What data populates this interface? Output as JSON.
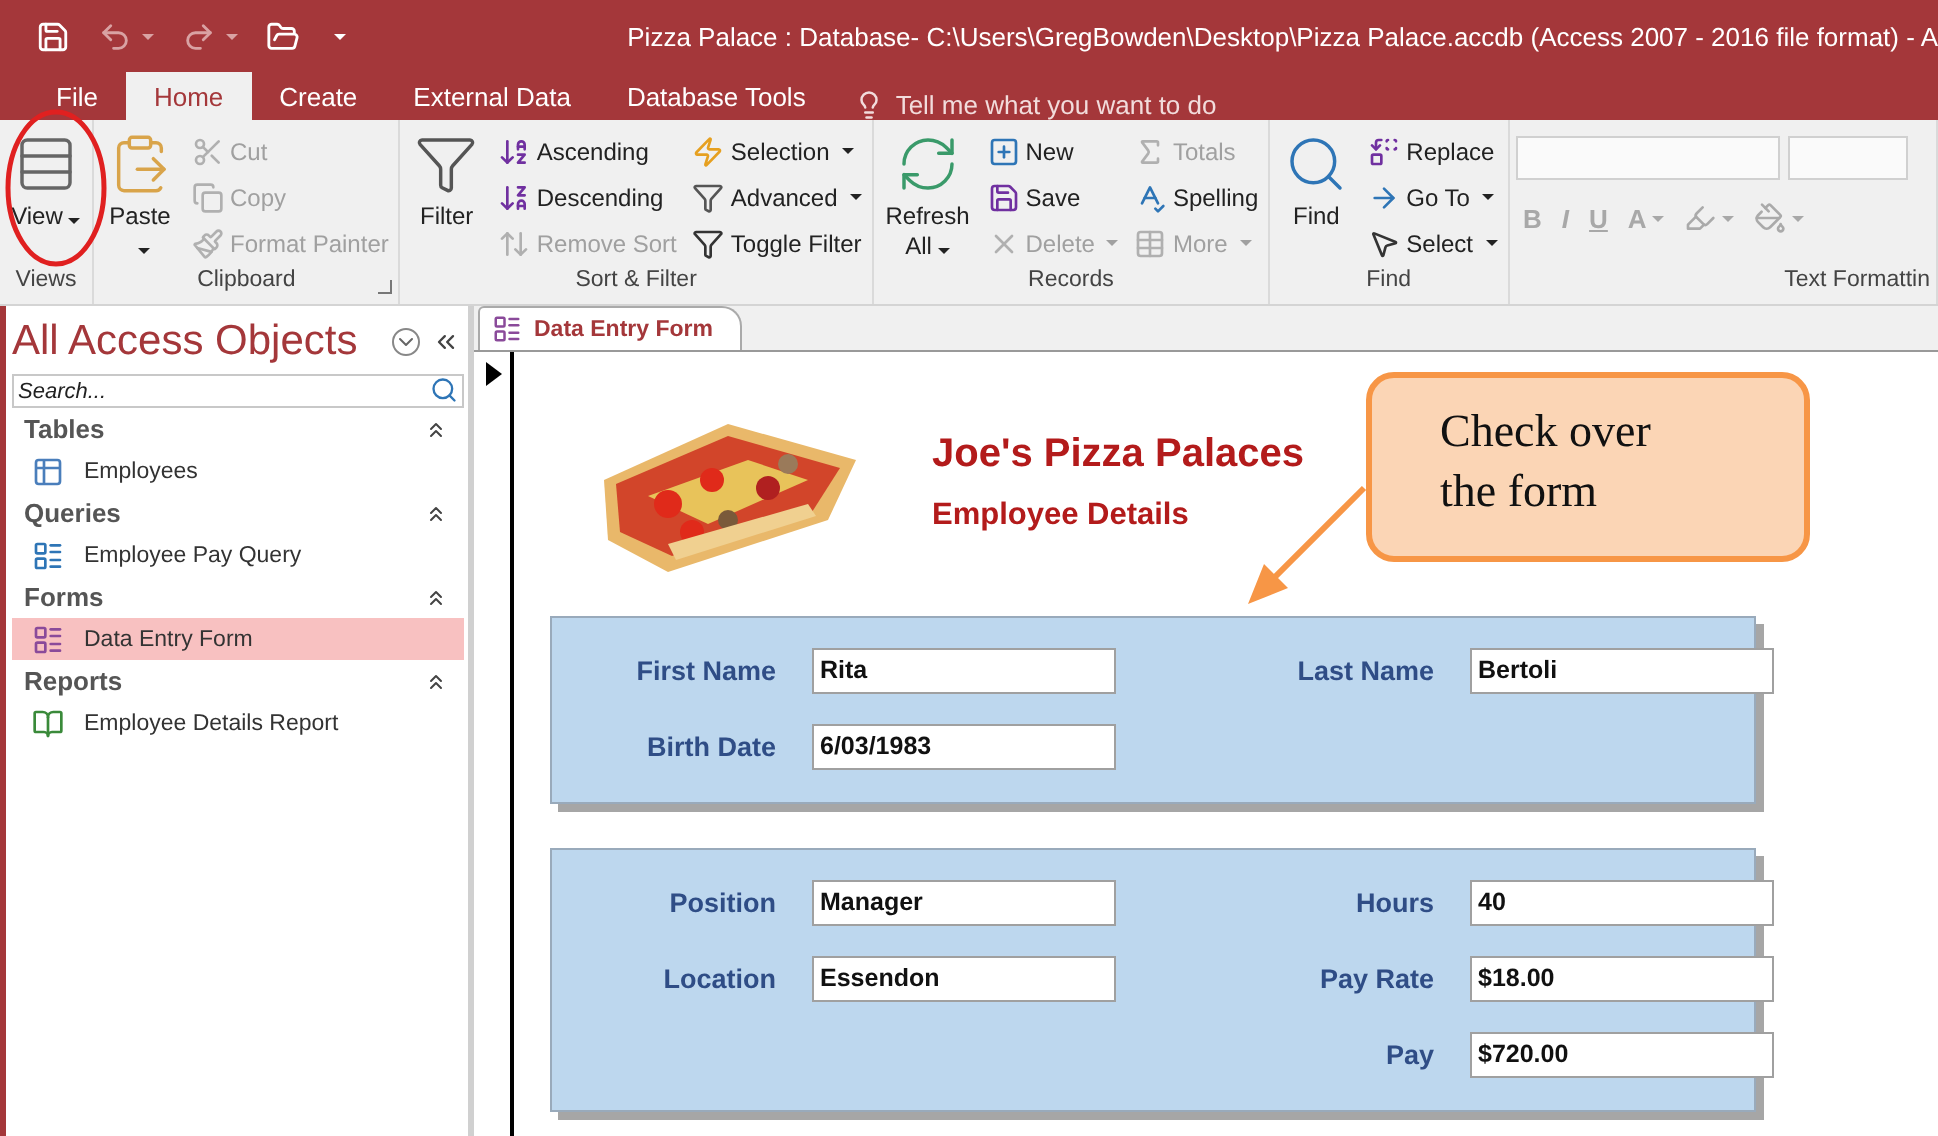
{
  "quick_access": [
    {
      "disabled": false,
      "dropdown": false
    },
    {
      "disabled": true,
      "dropdown": true
    },
    {
      "disabled": true,
      "dropdown": true
    },
    {
      "disabled": false,
      "dropdown": false
    },
    {
      "disabled": false,
      "dropdown": true
    }
  ],
  "window": {
    "title": "Pizza Palace : Database- C:\\Users\\GregBowden\\Desktop\\Pizza Palace.accdb (Access 2007 - 2016 file format) - A"
  },
  "ribbon_tabs": [
    {
      "label": "File",
      "selected": false
    },
    {
      "label": "Home",
      "selected": true
    },
    {
      "label": "Create",
      "selected": false
    },
    {
      "label": "External Data",
      "selected": false
    },
    {
      "label": "Database Tools",
      "selected": false
    }
  ],
  "tell_me": {
    "placeholder": "Tell me what you want to do"
  },
  "ribbon_groups": [
    {
      "label": "Views",
      "launcher": false,
      "items": [
        {
          "kind": "large",
          "label": "View",
          "disabled": false,
          "dropdown": true
        }
      ]
    },
    {
      "label": "Clipboard",
      "launcher": true,
      "items": [
        {
          "kind": "large",
          "label": "Paste",
          "disabled": false,
          "dropdown": true
        },
        {
          "kind": "small",
          "label": "Cut",
          "disabled": true,
          "dropdown": false
        },
        {
          "kind": "small",
          "label": "Copy",
          "disabled": true,
          "dropdown": false
        },
        {
          "kind": "small",
          "label": "Format Painter",
          "disabled": true,
          "dropdown": false
        }
      ]
    },
    {
      "label": "Sort & Filter",
      "launcher": false,
      "items": [
        {
          "kind": "large",
          "label": "Filter",
          "disabled": false,
          "dropdown": false
        },
        {
          "kind": "small",
          "label": "Ascending",
          "disabled": false,
          "dropdown": false
        },
        {
          "kind": "small",
          "label": "Descending",
          "disabled": false,
          "dropdown": false
        },
        {
          "kind": "small",
          "label": "Remove Sort",
          "disabled": true,
          "dropdown": false
        },
        {
          "kind": "small",
          "label": "Selection",
          "disabled": false,
          "dropdown": true
        },
        {
          "kind": "small",
          "label": "Advanced",
          "disabled": false,
          "dropdown": true
        },
        {
          "kind": "small",
          "label": "Toggle Filter",
          "disabled": false,
          "dropdown": false
        }
      ]
    },
    {
      "label": "Records",
      "launcher": false,
      "items": [
        {
          "kind": "large",
          "label": "Refresh All",
          "disabled": false,
          "dropdown": true
        },
        {
          "kind": "small",
          "label": "New",
          "disabled": false,
          "dropdown": false
        },
        {
          "kind": "small",
          "label": "Save",
          "disabled": false,
          "dropdown": false
        },
        {
          "kind": "small",
          "label": "Delete",
          "disabled": true,
          "dropdown": true
        },
        {
          "kind": "small",
          "label": "Totals",
          "disabled": true,
          "dropdown": false
        },
        {
          "kind": "small",
          "label": "Spelling",
          "disabled": false,
          "dropdown": false
        },
        {
          "kind": "small",
          "label": "More",
          "disabled": true,
          "dropdown": true
        }
      ]
    },
    {
      "label": "Find",
      "launcher": false,
      "items": [
        {
          "kind": "large",
          "label": "Find",
          "disabled": false,
          "dropdown": false
        },
        {
          "kind": "small",
          "label": "Replace",
          "disabled": false,
          "dropdown": false
        },
        {
          "kind": "small",
          "label": "Go To",
          "disabled": false,
          "dropdown": true
        },
        {
          "kind": "small",
          "label": "Select",
          "disabled": false,
          "dropdown": true
        }
      ]
    },
    {
      "label": "Text Formattin",
      "launcher": false,
      "items": [
        {
          "kind": "combo",
          "disabled": true
        },
        {
          "kind": "combo",
          "disabled": true
        },
        {
          "kind": "format",
          "label": "B",
          "disabled": true,
          "dropdown": false
        },
        {
          "kind": "format",
          "label": "I",
          "disabled": true,
          "dropdown": false
        },
        {
          "kind": "format",
          "label": "U",
          "disabled": true,
          "dropdown": false
        },
        {
          "kind": "format",
          "label": "A",
          "disabled": true,
          "dropdown": true
        },
        {
          "kind": "format",
          "disabled": true,
          "dropdown": true
        },
        {
          "kind": "format",
          "disabled": true,
          "dropdown": true
        }
      ]
    }
  ],
  "navigation": {
    "title": "All Access Objects",
    "search": {
      "placeholder": "Search..."
    },
    "groups": [
      {
        "label": "Tables",
        "expanded": true,
        "items": [
          {
            "label": "Employees",
            "selected": false
          }
        ]
      },
      {
        "label": "Queries",
        "expanded": true,
        "items": [
          {
            "label": "Employee Pay Query",
            "selected": false
          }
        ]
      },
      {
        "label": "Forms",
        "expanded": true,
        "items": [
          {
            "label": "Data Entry Form",
            "selected": true
          }
        ]
      },
      {
        "label": "Reports",
        "expanded": true,
        "items": [
          {
            "label": "Employee Details Report",
            "selected": false
          }
        ]
      }
    ]
  },
  "document_tabs": [
    {
      "label": "Data Entry Form",
      "selected": true
    }
  ],
  "form": {
    "title": "Joe's Pizza Palaces",
    "subtitle": "Employee Details",
    "panels": [
      {
        "rows": [
          {
            "left": {
              "label": "First Name",
              "value": "Rita"
            },
            "right": {
              "label": "Last Name",
              "value": "Bertoli"
            }
          },
          {
            "left": {
              "label": "Birth Date",
              "value": "6/03/1983"
            }
          }
        ]
      },
      {
        "rows": [
          {
            "left": {
              "label": "Position",
              "value": "Manager"
            },
            "right": {
              "label": "Hours",
              "value": "40"
            }
          },
          {
            "left": {
              "label": "Location",
              "value": "Essendon"
            },
            "right": {
              "label": "Pay Rate",
              "value": "$18.00"
            }
          },
          {
            "right": {
              "label": "Pay",
              "value": "$720.00"
            }
          }
        ]
      }
    ]
  },
  "callout": {
    "text": "Check over the form"
  }
}
